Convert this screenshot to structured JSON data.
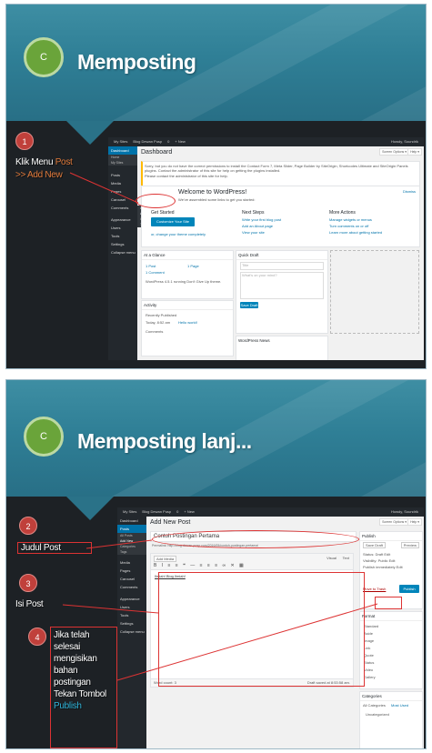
{
  "slides": [
    {
      "badge": "C",
      "title": "Memposting",
      "steps": [
        {
          "num": "1",
          "text": "Klik Menu ",
          "hl1": "Post",
          "hl2": ">> Add New"
        }
      ],
      "wp": {
        "topbar": [
          "My Sites",
          "Blog Dewan Pusp",
          "0",
          "+ New"
        ],
        "howdy": "Howdy, Soundrik",
        "screen_options": "Screen Options ▾",
        "help": "Help ▾",
        "sidebar": [
          "Dashboard",
          "Home",
          "My Sites",
          "Posts",
          "Media",
          "Pages",
          "Carousel",
          "Comments",
          "Appearance",
          "Users",
          "Tools",
          "Settings",
          "Collapse menu"
        ],
        "submenu": [
          "All Posts",
          "Add New",
          "Categories",
          "Tags"
        ],
        "heading": "Dashboard",
        "notice": "Sorry, but you do not have the correct permissions to install the Contact Form 7, Meta Slider, Page Builder by SiteOrigin, Shortcodes Ultimate and SiteOrigin Panels plugins. Contact the administrator of this site for help on getting the plugins installed.",
        "notice2": "Please contact the administrator of this site for help.",
        "welcome": "Welcome to WordPress!",
        "welcome_sub": "We've assembled some links to get you started:",
        "dismiss": "Dismiss",
        "get_started": "Get Started",
        "customize": "Customize Your Site",
        "change_theme": "or, change your theme completely",
        "next_steps": "Next Steps",
        "next_items": [
          "Write your first blog post",
          "Add an About page",
          "View your site"
        ],
        "more_actions": "More Actions",
        "more_items": [
          "Manage widgets or menus",
          "Turn comments on or off",
          "Learn more about getting started"
        ],
        "glance": "At a Glance",
        "glance_items": [
          "1 Post",
          "1 Page",
          "1 Comment"
        ],
        "wp_version": "WordPress 4.5.1 running Don't Give Up theme.",
        "activity": "Activity",
        "recent": "Recently Published",
        "recent_item": "Today, 8:52 am",
        "recent_link": "Hello world!",
        "comments": "Comments",
        "quick_draft": "Quick Draft",
        "qd_title": "Title",
        "qd_body": "What's on your mind?",
        "save_draft": "Save Draft",
        "wp_news": "WordPress News"
      }
    },
    {
      "badge": "C",
      "title": "Memposting lanj...",
      "steps": [
        {
          "num": "2",
          "text": "Judul Post"
        },
        {
          "num": "3",
          "text": "Isi Post"
        },
        {
          "num": "4",
          "lines": [
            "Jika telah",
            "selesai",
            "mengisikan",
            "bahan",
            "postingan",
            "Tekan Tombol"
          ],
          "hl": "Publish"
        }
      ],
      "wp": {
        "topbar": [
          "My Sites",
          "Blog Dewan Pusp",
          "0",
          "+ New"
        ],
        "howdy": "Howdy, Soundrik",
        "screen_options": "Screen Options ▾",
        "help": "Help ▾",
        "sidebar": [
          "Dashboard",
          "Posts",
          "All Posts",
          "Add New",
          "Categories",
          "Tags",
          "Media",
          "Pages",
          "Carousel",
          "Comments",
          "Appearance",
          "Users",
          "Tools",
          "Settings",
          "Collapse menu"
        ],
        "heading": "Add New Post",
        "post_title": "Contoh Postingan Pertama",
        "permalink": "Permalink: http://blog-dewan-pusp.com/2016/05/contoh-postingan-pertama/",
        "edit": "Edit",
        "add_media": "Add Media",
        "visual": "Visual",
        "text": "Text",
        "body": "Ilmiah! Blog Ilmiah!",
        "word_count": "Word count: 3",
        "draft_saved": "Draft saved at 8:53:58 am.",
        "publish": "Publish",
        "save_draft": "Save Draft",
        "preview": "Preview",
        "status": "Status: Draft Edit",
        "visibility": "Visibility: Public Edit",
        "pub_time": "Publish immediately Edit",
        "trash": "Move to Trash",
        "publish_btn": "Publish",
        "format": "Format",
        "formats": [
          "Standard",
          "Aside",
          "Image",
          "Link",
          "Quote",
          "Status",
          "Video",
          "Gallery"
        ],
        "categories": "Categories",
        "cat_tabs": [
          "All Categories",
          "Most Used"
        ],
        "cat_item": "Uncategorized"
      }
    }
  ]
}
